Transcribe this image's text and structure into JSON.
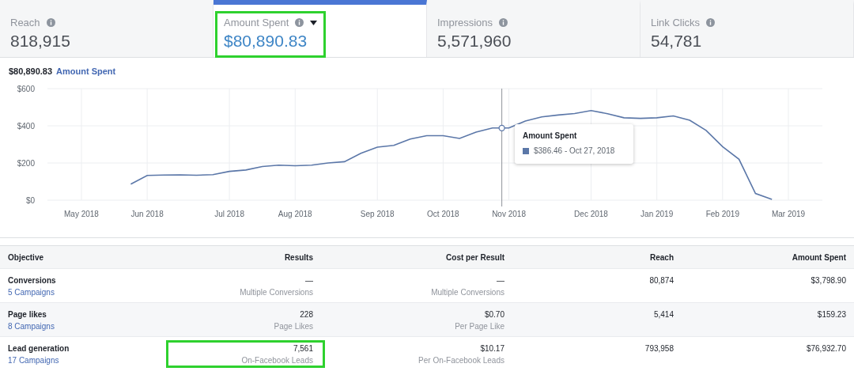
{
  "tabs": [
    {
      "label": "Reach",
      "value": "818,915",
      "selected": false,
      "dropdown": false,
      "highlighted": false
    },
    {
      "label": "Amount Spent",
      "value": "$80,890.83",
      "selected": true,
      "dropdown": true,
      "highlighted": true
    },
    {
      "label": "Impressions",
      "value": "5,571,960",
      "selected": false,
      "dropdown": false,
      "highlighted": false
    },
    {
      "label": "Link Clicks",
      "value": "54,781",
      "selected": false,
      "dropdown": false,
      "highlighted": false
    }
  ],
  "chart": {
    "total": "$80,890.83",
    "tooltip": {
      "title": "Amount Spent",
      "text": "$386.46 - Oct 27, 2018"
    },
    "chart_data": {
      "type": "line",
      "grid": true,
      "ylim": [
        0,
        600
      ],
      "categories": [
        null,
        "May 2018",
        null,
        null,
        null,
        "Jun 2018",
        null,
        null,
        null,
        null,
        "Jul 2018",
        null,
        null,
        null,
        "Aug 2018",
        null,
        null,
        null,
        null,
        "Sep 2018",
        null,
        null,
        null,
        "Oct 2018",
        null,
        null,
        null,
        "Nov 2018",
        null,
        null,
        null,
        null,
        "Dec 2018",
        null,
        null,
        null,
        "Jan 2019",
        null,
        null,
        null,
        "Feb 2019",
        null,
        null,
        null,
        "Mar 2019"
      ],
      "yticks": [
        {
          "value": 0,
          "label": "$0"
        },
        {
          "value": 200,
          "label": "$200"
        },
        {
          "value": 400,
          "label": "$400"
        },
        {
          "value": 600,
          "label": "$600"
        }
      ],
      "series": [
        {
          "name": "Amount Spent",
          "color": "#5b77a8",
          "values": [
            null,
            null,
            null,
            null,
            86,
            133,
            135,
            136,
            134,
            137,
            155,
            162,
            181,
            188,
            185,
            188,
            200,
            207,
            252,
            285,
            295,
            329,
            347,
            347,
            332,
            366,
            388,
            388,
            426,
            448,
            458,
            466,
            482,
            465,
            443,
            440,
            443,
            453,
            430,
            375,
            288,
            220,
            36,
            4,
            null
          ]
        }
      ]
    }
  },
  "table": {
    "columns": [
      "Objective",
      "Results",
      "Cost per Result",
      "Reach",
      "Amount Spent"
    ],
    "rows": [
      {
        "objective": "Conversions",
        "campaigns": "5 Campaigns",
        "results": "—",
        "results_unit": "Multiple Conversions",
        "cost": "—",
        "cost_unit": "Multiple Conversions",
        "reach": "80,874",
        "amount": "$3,798.90",
        "highlighted": false
      },
      {
        "objective": "Page likes",
        "campaigns": "8 Campaigns",
        "results": "228",
        "results_unit": "Page Likes",
        "cost": "$0.70",
        "cost_unit": "Per Page Like",
        "reach": "5,414",
        "amount": "$159.23",
        "highlighted": false
      },
      {
        "objective": "Lead generation",
        "campaigns": "17 Campaigns",
        "results": "7,561",
        "results_unit": "On-Facebook Leads",
        "cost": "$10.17",
        "cost_unit": "Per On-Facebook Leads",
        "reach": "793,958",
        "amount": "$76,932.70",
        "highlighted": true
      }
    ]
  }
}
